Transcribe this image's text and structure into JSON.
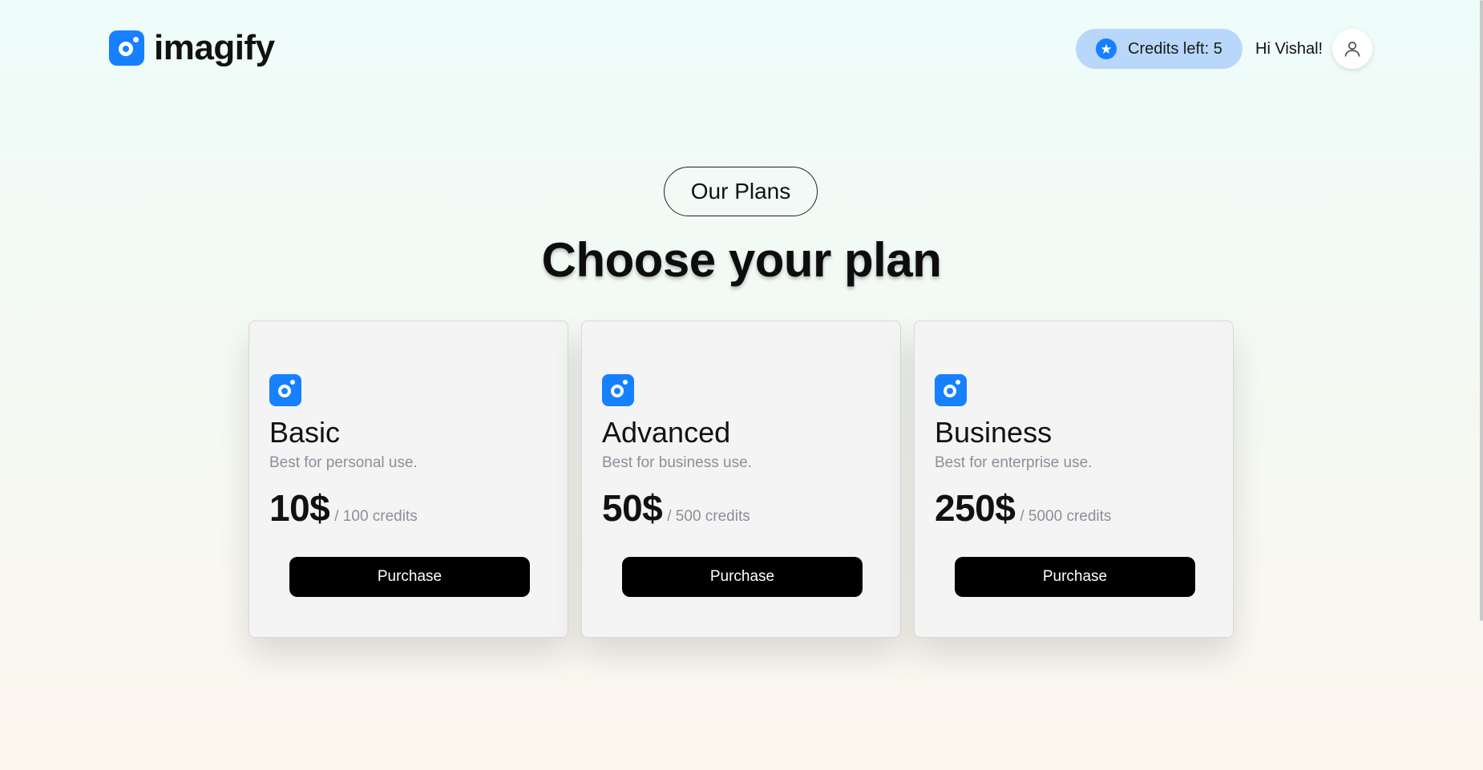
{
  "app": {
    "name": "imagify",
    "logo_icon": "imagify-logo-icon"
  },
  "header": {
    "credits_label": "Credits left: 5",
    "credits_icon": "star-icon",
    "greeting": "Hi Vishal!",
    "avatar_icon": "user-icon"
  },
  "hero": {
    "badge": "Our Plans",
    "title": "Choose your plan"
  },
  "plans": [
    {
      "name": "Basic",
      "description": "Best for personal use.",
      "price": "10$",
      "credits": "/ 100 credits",
      "button": "Purchase"
    },
    {
      "name": "Advanced",
      "description": "Best for business use.",
      "price": "50$",
      "credits": "/ 500 credits",
      "button": "Purchase"
    },
    {
      "name": "Business",
      "description": "Best for enterprise use.",
      "price": "250$",
      "credits": "/ 5000 credits",
      "button": "Purchase"
    }
  ],
  "colors": {
    "accent": "#1680ff",
    "credits_pill": "#b8d7fb",
    "button": "#000000"
  }
}
